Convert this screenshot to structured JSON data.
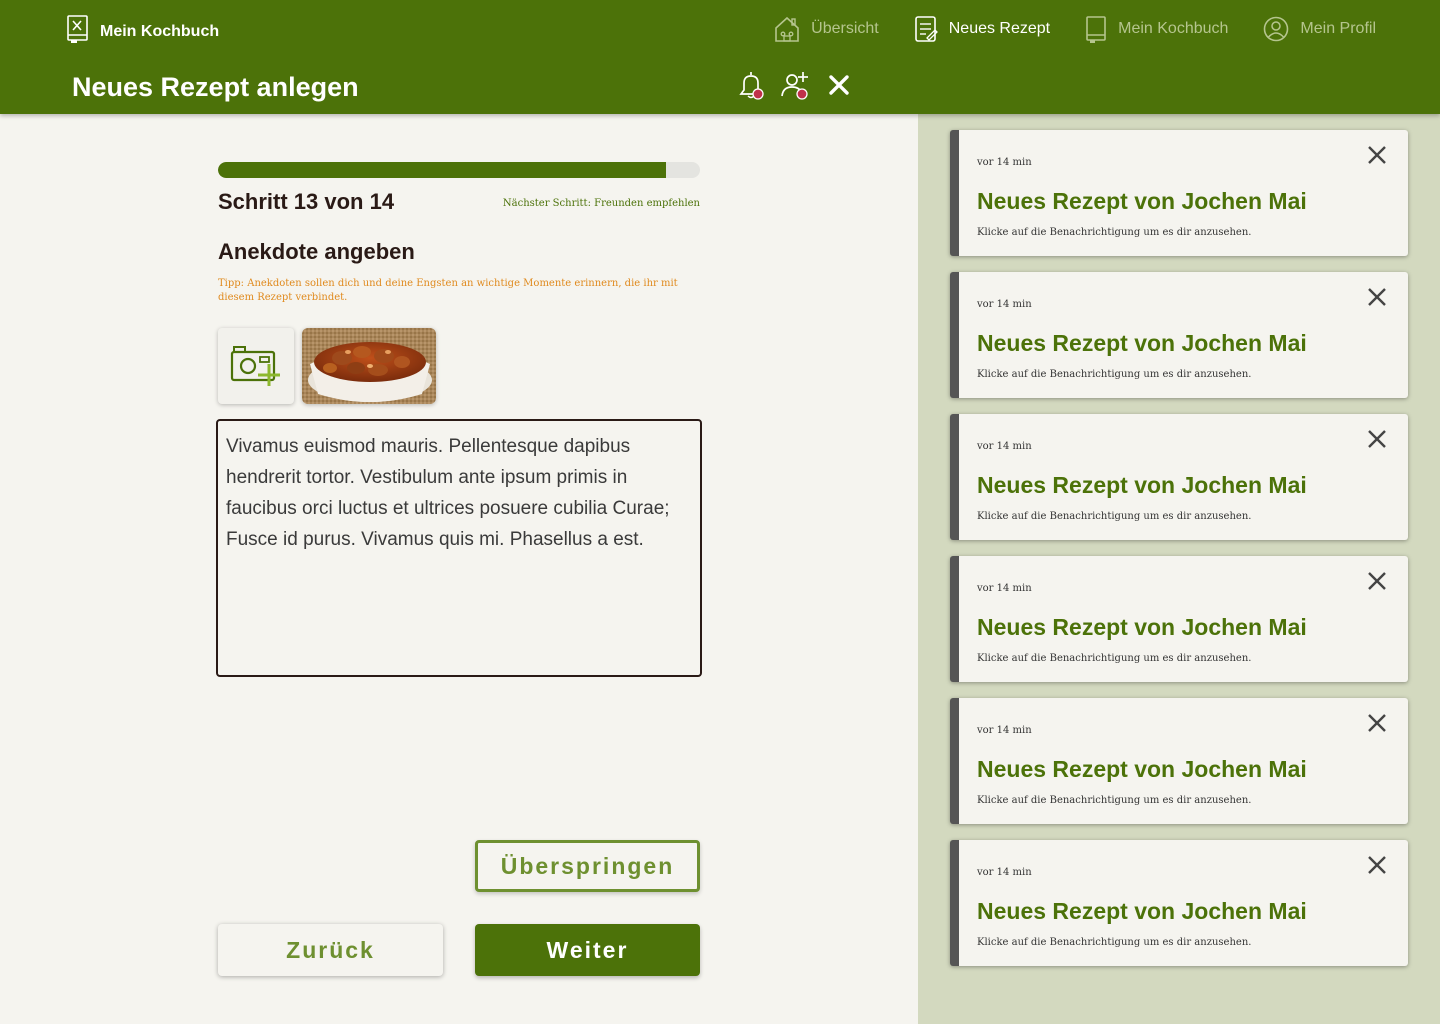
{
  "header": {
    "brand": "Mein Kochbuch",
    "nav": [
      {
        "label": "Übersicht",
        "icon": "home-icon",
        "active": false
      },
      {
        "label": "Neues Rezept",
        "icon": "recipe-note-icon",
        "active": true
      },
      {
        "label": "Mein Kochbuch",
        "icon": "cookbook-icon",
        "active": false
      },
      {
        "label": "Mein Profil",
        "icon": "profile-icon",
        "active": false
      }
    ],
    "page_title": "Neues Rezept anlegen",
    "actions": [
      "notification-bell-icon",
      "add-friend-icon",
      "close-icon"
    ]
  },
  "form": {
    "progress": 0.93,
    "step_label": "Schritt 13 von 14",
    "next_step": "Nächster Schritt: Freunden empfehlen",
    "section_title": "Anekdote angeben",
    "tip": "Tipp: Anekdoten sollen dich und deine Engsten an wichtige Momente erinnern, die ihr mit diesem Rezept verbindet.",
    "anecdote_value": "Vivamus euismod mauris. Pellentesque dapibus hendrerit tortor. Vestibulum ante ipsum primis in faucibus orci luctus et ultrices posuere cubilia Curae; Fusce id purus. Vivamus quis mi. Phasellus a est.",
    "skip_label": "Überspringen",
    "back_label": "Zurück",
    "next_label": "Weiter"
  },
  "notifications": [
    {
      "time": "vor 14 min",
      "title": "Neues Rezept von Jochen Mai",
      "text": "Klicke auf die Benachrichtigung um es dir anzusehen."
    },
    {
      "time": "vor 14 min",
      "title": "Neues Rezept von Jochen Mai",
      "text": "Klicke auf die Benachrichtigung um es dir anzusehen."
    },
    {
      "time": "vor 14 min",
      "title": "Neues Rezept von Jochen Mai",
      "text": "Klicke auf die Benachrichtigung um es dir anzusehen."
    },
    {
      "time": "vor 14 min",
      "title": "Neues Rezept von Jochen Mai",
      "text": "Klicke auf die Benachrichtigung um es dir anzusehen."
    },
    {
      "time": "vor 14 min",
      "title": "Neues Rezept von Jochen Mai",
      "text": "Klicke auf die Benachrichtigung um es dir anzusehen."
    },
    {
      "time": "vor 14 min",
      "title": "Neues Rezept von Jochen Mai",
      "text": "Klicke auf die Benachrichtigung um es dir anzusehen."
    }
  ],
  "colors": {
    "brand_green": "#4c7209",
    "accent_orange": "#e08a1e",
    "sidebar_bg": "#d3d9bf",
    "badge_red": "#c0304a"
  }
}
